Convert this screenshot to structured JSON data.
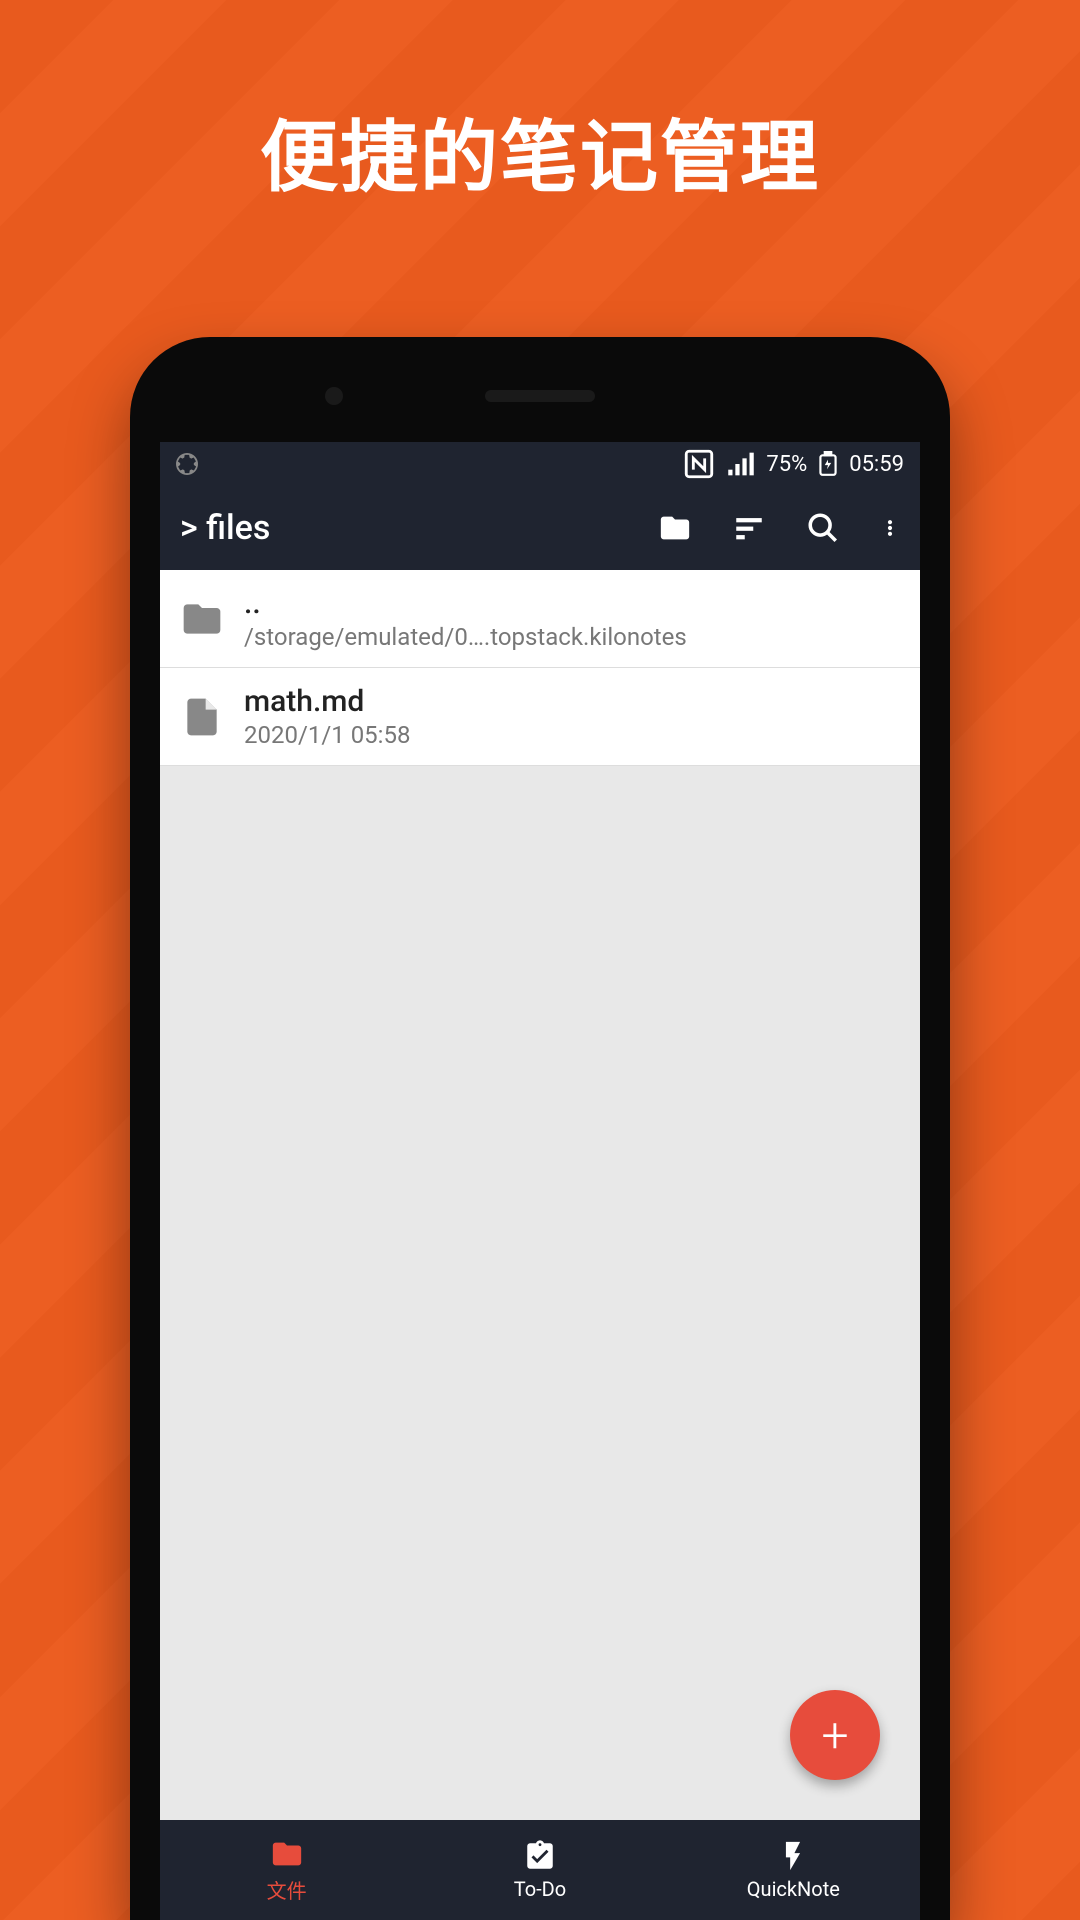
{
  "hero": {
    "title": "便捷的笔记管理"
  },
  "statusBar": {
    "battery": "75%",
    "time": "05:59"
  },
  "appBar": {
    "title": "> files"
  },
  "files": [
    {
      "type": "folder-up",
      "name": "..",
      "sub": "/storage/emulated/0….topstack.kilonotes"
    },
    {
      "type": "file",
      "name": "math.md",
      "sub": "2020/1/1 05:58"
    }
  ],
  "bottomNav": [
    {
      "label": "文件",
      "active": true
    },
    {
      "label": "To-Do",
      "active": false
    },
    {
      "label": "QuickNote",
      "active": false
    }
  ]
}
